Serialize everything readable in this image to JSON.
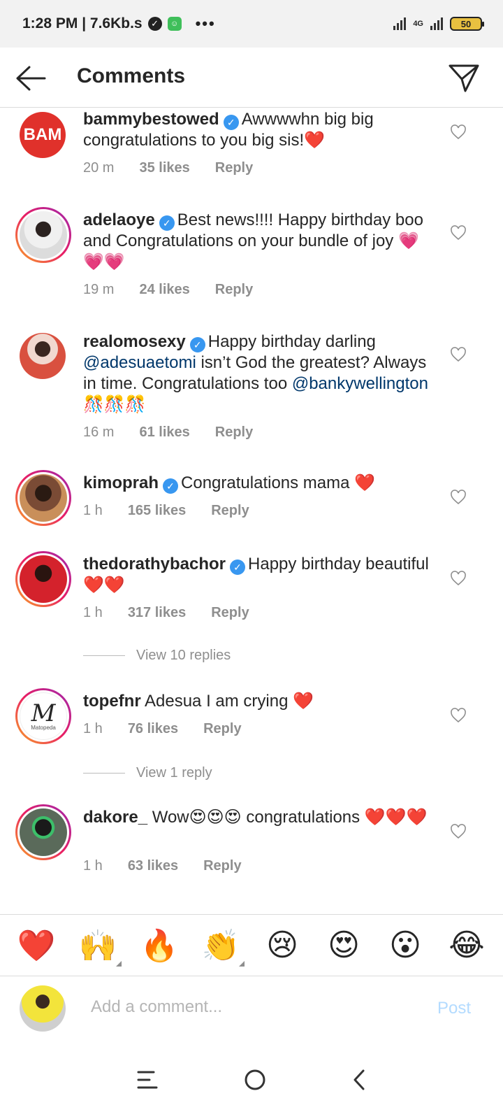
{
  "status_bar": {
    "time_speed": "1:28 PM | 7.6Kb.s",
    "dots": "•••",
    "network": "4G",
    "battery": "50"
  },
  "header": {
    "title": "Comments",
    "back_icon": "arrow-left-icon",
    "send_icon": "paper-plane-icon"
  },
  "comments": [
    {
      "user": "bammybestowed",
      "verified": true,
      "text": "Awwwwhn big big congratulations to you big sis!❤️",
      "time": "20 m",
      "likes": "35 likes",
      "reply": "Reply",
      "avatar_color": "#e0312b",
      "avatar_text": "BAM"
    },
    {
      "user": "adelaoye",
      "verified": true,
      "text": "Best news!!!! Happy birthday boo and Congratulations on your bundle of joy 💗💗💗",
      "time": "19 m",
      "likes": "24 likes",
      "reply": "Reply",
      "avatar_color": "#e9e9e9"
    },
    {
      "user": "realomosexy",
      "verified": true,
      "text_parts": [
        "Happy birthday darling ",
        "@adesuaetomi",
        " isn’t God the greatest? Always in time. Congratulations too ",
        "@bankywellington",
        " 🎊🎊🎊"
      ],
      "time": "16 m",
      "likes": "61 likes",
      "reply": "Reply",
      "avatar_color": "#d9503f"
    },
    {
      "user": "kimoprah",
      "verified": true,
      "text": "Congratulations mama ❤️",
      "time": "1 h",
      "likes": "165 likes",
      "reply": "Reply",
      "avatar_color": "#7a4b35"
    },
    {
      "user": "thedorathybachor",
      "verified": true,
      "text": "Happy birthday beautiful ❤️❤️",
      "time": "1 h",
      "likes": "317 likes",
      "reply": "Reply",
      "avatar_color": "#d4222c",
      "view_replies": "View 10 replies"
    },
    {
      "user": "topefnr",
      "verified": false,
      "text": "Adesua I am crying ❤️",
      "time": "1 h",
      "likes": "76 likes",
      "reply": "Reply",
      "avatar_color": "#ffffff",
      "avatar_text": "Matopeda",
      "view_replies": "View 1 reply"
    },
    {
      "user": "dakore_",
      "verified": true,
      "text": "Wow😍😍😍 congratulations ❤️❤️❤️",
      "time": "1 h",
      "likes": "63 likes",
      "reply": "Reply",
      "avatar_color": "#5a6a5a"
    }
  ],
  "emoji_bar": [
    "❤️",
    "🙌",
    "🔥",
    "👏",
    "😢",
    "😍",
    "😮",
    "😂"
  ],
  "composer": {
    "placeholder": "Add a comment...",
    "post_label": "Post"
  },
  "colors": {
    "accent_blue": "#3897f0",
    "mention": "#00376b",
    "meta_gray": "#8e8e8e",
    "post_disabled": "#b3dbff"
  }
}
